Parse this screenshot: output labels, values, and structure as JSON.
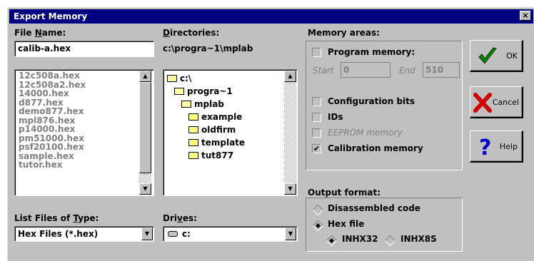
{
  "window": {
    "title": "Export Memory",
    "close_label": "×"
  },
  "file_name": {
    "label_pre": "File ",
    "label_key": "N",
    "label_post": "ame:",
    "value": "calib-a.hex",
    "files": [
      "12c508a.hex",
      "12c508a2.hex",
      "14000.hex",
      "d877.hex",
      "demo877.hex",
      "mpl876.hex",
      "p14000.hex",
      "pm51000.hex",
      "psf20100.hex",
      "sample.hex",
      "tutor.hex"
    ]
  },
  "directories": {
    "label_pre": "",
    "label_key": "D",
    "label_post": "irectories:",
    "path": "c:\\progra~1\\mplab",
    "items": [
      {
        "name": "c:\\",
        "indent": 0,
        "open": true
      },
      {
        "name": "progra~1",
        "indent": 1,
        "open": true
      },
      {
        "name": "mplab",
        "indent": 2,
        "open": true
      },
      {
        "name": "example",
        "indent": 3,
        "open": false
      },
      {
        "name": "oldfirm",
        "indent": 3,
        "open": false
      },
      {
        "name": "template",
        "indent": 3,
        "open": false
      },
      {
        "name": "tut877",
        "indent": 3,
        "open": false
      }
    ]
  },
  "list_type": {
    "label_pre": "List Files of ",
    "label_key": "T",
    "label_post": "ype:",
    "value": "Hex Files (*.hex)"
  },
  "drives": {
    "label_pre": "Dri",
    "label_key": "v",
    "label_post": "es:",
    "value": "c:"
  },
  "memory_areas": {
    "title": "Memory areas:",
    "program_memory": {
      "label": "Program memory:",
      "checked": false
    },
    "start_label": "Start",
    "start_value": "0",
    "end_label": "End",
    "end_value": "510",
    "configuration_bits": {
      "label": "Configuration bits",
      "checked": false
    },
    "ids": {
      "label": "IDs",
      "checked": false
    },
    "eeprom_memory": {
      "label": "EEPROM memory",
      "checked": false
    },
    "calibration_memory": {
      "label": "Calibration memory",
      "checked": true,
      "mark": "✔"
    }
  },
  "output_format": {
    "title": "Output format:",
    "disassembled": "Disassembled code",
    "hex_file": "Hex file",
    "inhx32": "INHX32",
    "inhx8s": "INHX8S"
  },
  "buttons": {
    "ok": "OK",
    "cancel": "Cancel",
    "help": "Help"
  },
  "colors": {
    "title_bar": "#000080",
    "face": "#c0c0c0",
    "ok_check": "#008000",
    "cancel_x": "#cc0000",
    "help_q": "#0000cc"
  }
}
